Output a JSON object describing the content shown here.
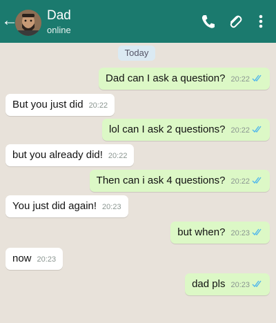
{
  "header": {
    "contact_name": "Dad",
    "status": "online"
  },
  "chat": {
    "date_divider": "Today",
    "messages": [
      {
        "direction": "outgoing",
        "text": "Dad can I ask a question?",
        "time": "20:22"
      },
      {
        "direction": "incoming",
        "text": "But you just did",
        "time": "20:22"
      },
      {
        "direction": "outgoing",
        "text": "lol can I ask 2 questions?",
        "time": "20:22"
      },
      {
        "direction": "incoming",
        "text": "but you already did!",
        "time": "20:22"
      },
      {
        "direction": "outgoing",
        "text": "Then can i ask 4 questions?",
        "time": "20:22"
      },
      {
        "direction": "incoming",
        "text": "You just did again!",
        "time": "20:23"
      },
      {
        "direction": "outgoing",
        "text": "but when?",
        "time": "20:23"
      },
      {
        "direction": "incoming",
        "text": "now",
        "time": "20:23"
      },
      {
        "direction": "outgoing",
        "text": "dad pls",
        "time": "20:23"
      }
    ]
  },
  "colors": {
    "header_bg": "#1b7a6e",
    "chat_bg": "#e8e2da",
    "outgoing_bubble": "#dcf8c6",
    "incoming_bubble": "#ffffff",
    "read_ticks": "#4fb6ec"
  },
  "icons": [
    "back-arrow-icon",
    "phone-icon",
    "paperclip-icon",
    "more-vert-icon",
    "double-check-icon"
  ]
}
